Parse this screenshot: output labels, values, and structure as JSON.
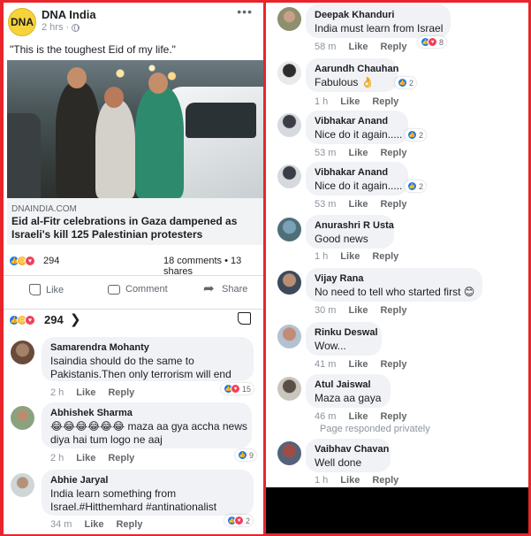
{
  "post": {
    "page_name": "DNA India",
    "logo_text": "DNA",
    "time": "2 hrs",
    "text": "\"This is the toughest Eid of my life.\"",
    "link_domain": "DNAINDIA.COM",
    "link_title": "Eid al-Fitr celebrations in Gaza dampened as Israeli's kill 125 Palestinian protesters",
    "reaction_count": "294",
    "share_stats": "18 comments • 13 shares",
    "actions": {
      "like": "Like",
      "comment": "Comment",
      "share": "Share"
    },
    "reaction_count_large": "294"
  },
  "left_comments": [
    {
      "name": "Samarendra Mohanty",
      "lines": [
        "Isaindia should do the same to",
        "Pakistanis.Then only terrorism will end"
      ],
      "time": "2 h",
      "like": "Like",
      "reply": "Reply",
      "reactions": "15"
    },
    {
      "name": "Abhishek Sharma",
      "lines": [
        "😂😂😂😂😂😂 maza aa gya accha news",
        "diya hai tum logo ne aaj"
      ],
      "time": "2 h",
      "like": "Like",
      "reply": "Reply",
      "reactions": "9"
    },
    {
      "name": "Abhie Jaryal",
      "lines": [
        "India learn something from",
        "Israel.#Hitthemhard #antinationalist"
      ],
      "time": "34 m",
      "like": "Like",
      "reply": "Reply",
      "reactions": "2"
    }
  ],
  "right_comments": [
    {
      "name": "Deepak Khanduri",
      "lines": [
        "India must learn from Israel"
      ],
      "time": "58 m",
      "like": "Like",
      "reply": "Reply",
      "reactions": "8"
    },
    {
      "name": "Aarundh Chauhan",
      "lines": [
        "Fabulous 👌"
      ],
      "time": "1 h",
      "like": "Like",
      "reply": "Reply",
      "reactions": "2"
    },
    {
      "name": "Vibhakar Anand",
      "lines": [
        "Nice do it again....."
      ],
      "time": "53 m",
      "like": "Like",
      "reply": "Reply",
      "reactions": "2"
    },
    {
      "name": "Vibhakar Anand",
      "lines": [
        "Nice do it again....."
      ],
      "time": "53 m",
      "like": "Like",
      "reply": "Reply",
      "reactions": "2"
    },
    {
      "name": "Anurashri R Usta",
      "lines": [
        "Good news"
      ],
      "time": "1 h",
      "like": "Like",
      "reply": "Reply"
    },
    {
      "name": "Vijay Rana",
      "lines": [
        "No need to tell who started first 😊"
      ],
      "time": "30 m",
      "like": "Like",
      "reply": "Reply"
    },
    {
      "name": "Rinku Deswal",
      "lines": [
        "Wow..."
      ],
      "time": "41 m",
      "like": "Like",
      "reply": "Reply"
    },
    {
      "name": "Atul Jaiswal",
      "lines": [
        "Maza  aa gaya"
      ],
      "time": "46 m",
      "like": "Like",
      "reply": "Reply"
    },
    {
      "name": "Vaibhav Chavan",
      "lines": [
        "Well done"
      ],
      "time": "1 h",
      "like": "Like",
      "reply": "Reply"
    }
  ],
  "page_responded_note": "Page responded privately",
  "colors": {
    "frame_red": "#e8252a",
    "like_blue": "#1877f2",
    "love_red": "#f33e58",
    "bubble_grey": "#f0f2f5"
  },
  "icons": [
    "globe-icon",
    "more-icon",
    "like-icon",
    "love-icon",
    "sad-icon",
    "thumb-icon",
    "comment-icon",
    "share-icon",
    "chevron-right-icon"
  ]
}
